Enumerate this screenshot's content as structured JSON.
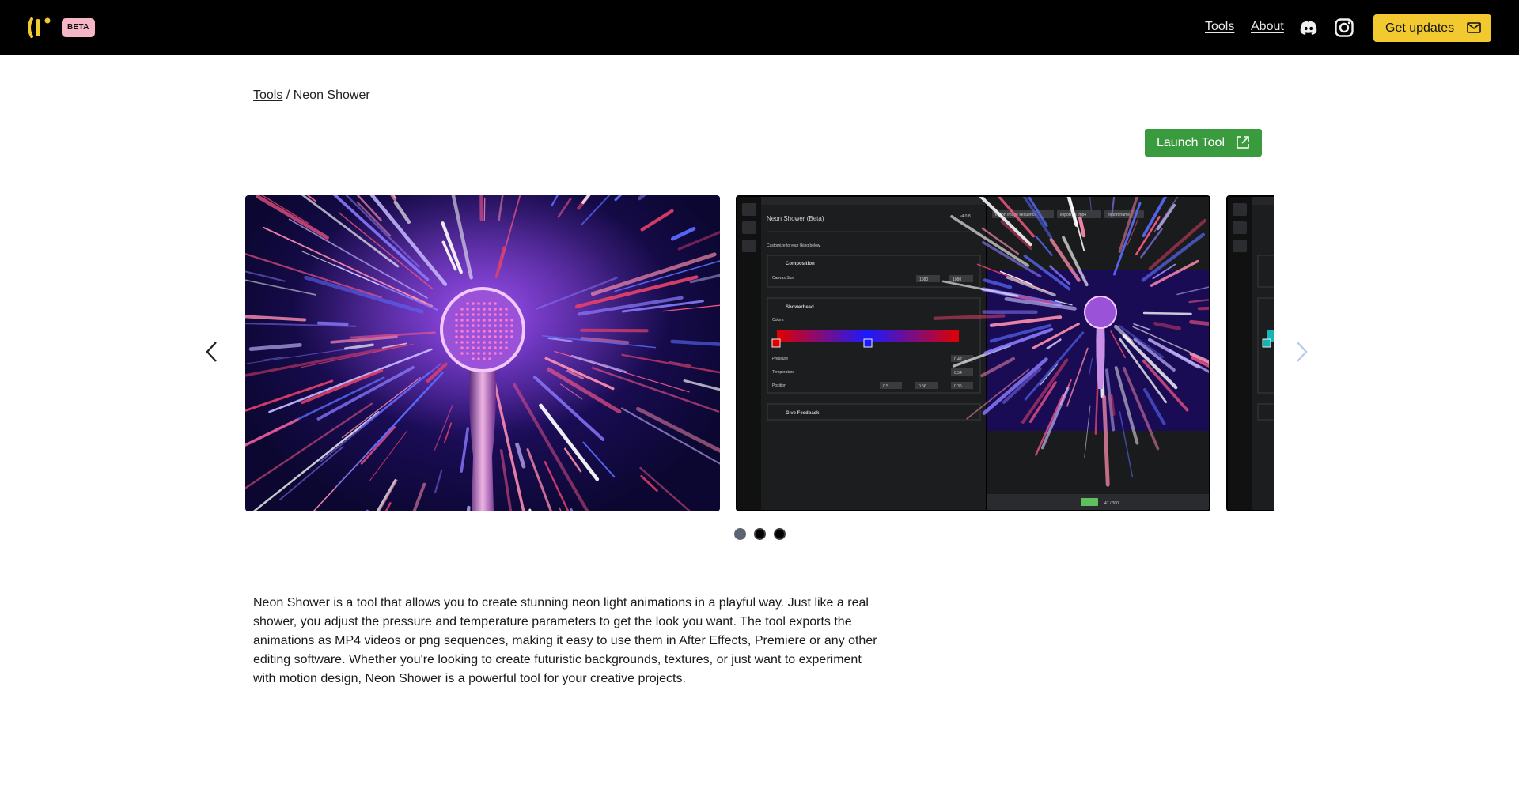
{
  "nav": {
    "beta_label": "BETA",
    "links": [
      {
        "label": "Tools"
      },
      {
        "label": "About"
      }
    ],
    "updates_label": "Get updates",
    "icons": [
      "logo-icon",
      "discord-icon",
      "instagram-icon",
      "mail-icon"
    ]
  },
  "breadcrumb": {
    "parent": "Tools",
    "separator": "/",
    "current": "Neon Shower"
  },
  "launch": {
    "label": "Launch Tool"
  },
  "carousel": {
    "slide_count": 3,
    "active_index": 0,
    "app_mock": {
      "title": "Neon Shower (Beta)",
      "version": "v4.0.8",
      "subtitle": "Customize to your liking below.",
      "export_buttons": [
        "export image sequence",
        "export as .mp4",
        "export frame"
      ],
      "sections": {
        "composition": "Composition",
        "canvas_size_label": "Canvas Size",
        "canvas_w": "1080",
        "canvas_h": "1080",
        "showerhead": "Showerhead",
        "colors_label": "Colors",
        "pressure_label": "Pressure",
        "pressure_value": "0.42",
        "temperature_label": "Temperature",
        "temperature_value": "0.54",
        "position_label": "Position",
        "pos_x": "0.5",
        "pos_y": "0.56",
        "pos_z": "0.35",
        "feedback": "Give Feedback",
        "frame_counter": "47 / 300"
      }
    }
  },
  "colors": {
    "accent_yellow": "#f2c92e",
    "launch_green": "#3a9a3e",
    "beta_pink": "#f7b6c5",
    "nav_bg": "#000000"
  },
  "description": "Neon Shower is a tool that allows you to create stunning neon light animations in a playful way. Just like a real shower, you adjust the pressure and temperature parameters to get the look you want. The tool exports the animations as MP4 videos or png sequences, making it easy to use them in After Effects, Premiere or any other editing software. Whether you're looking to create futuristic backgrounds, textures, or just want to experiment with motion design, Neon Shower is a powerful tool for your creative projects."
}
